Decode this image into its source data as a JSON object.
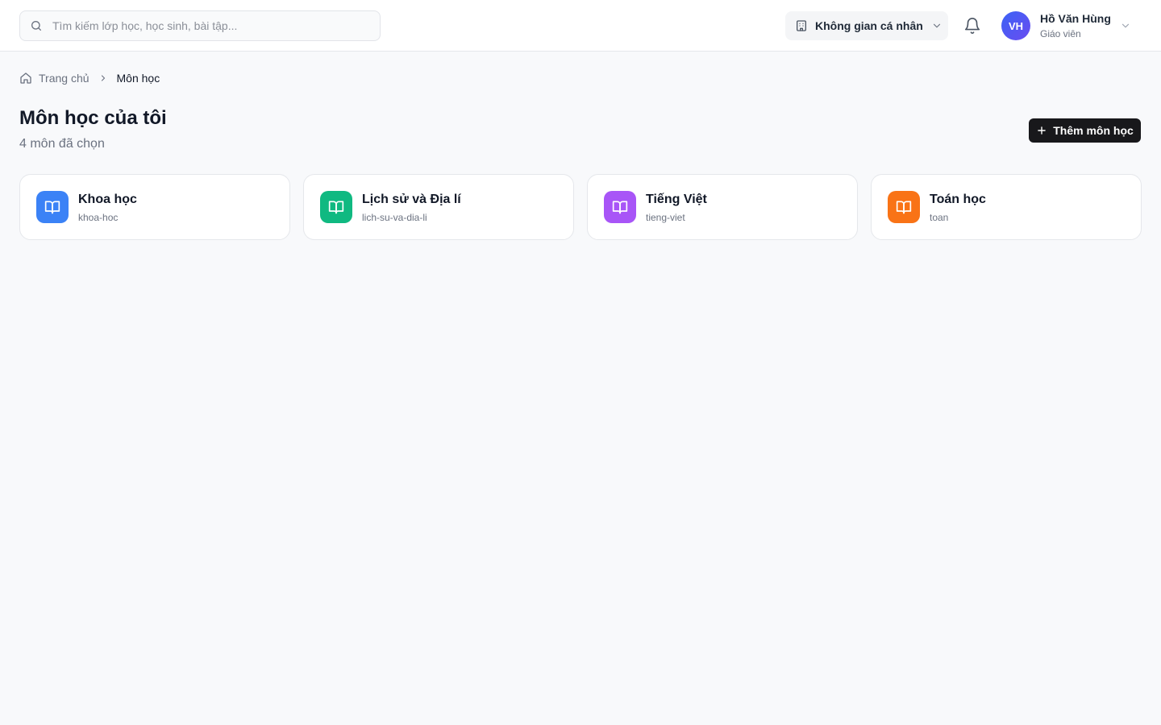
{
  "header": {
    "search_placeholder": "Tìm kiếm lớp học, học sinh, bài tập...",
    "workspace_label": "Không gian cá nhân",
    "user": {
      "initials": "VH",
      "name": "Hồ Văn Hùng",
      "role": "Giáo viên"
    }
  },
  "breadcrumb": {
    "home": "Trang chủ",
    "current": "Môn học"
  },
  "page": {
    "title": "Môn học của tôi",
    "subtitle": "4 môn đã chọn",
    "add_button": "Thêm môn học"
  },
  "subjects": [
    {
      "name": "Khoa học",
      "slug": "khoa-hoc",
      "color": "#3b82f6",
      "icon": "book-open-icon"
    },
    {
      "name": "Lịch sử và Địa lí",
      "slug": "lich-su-va-dia-li",
      "color": "#10b981",
      "icon": "book-open-icon"
    },
    {
      "name": "Tiếng Việt",
      "slug": "tieng-viet",
      "color": "#a855f7",
      "icon": "book-open-icon"
    },
    {
      "name": "Toán học",
      "slug": "toan",
      "color": "#f97316",
      "icon": "book-open-icon"
    }
  ]
}
